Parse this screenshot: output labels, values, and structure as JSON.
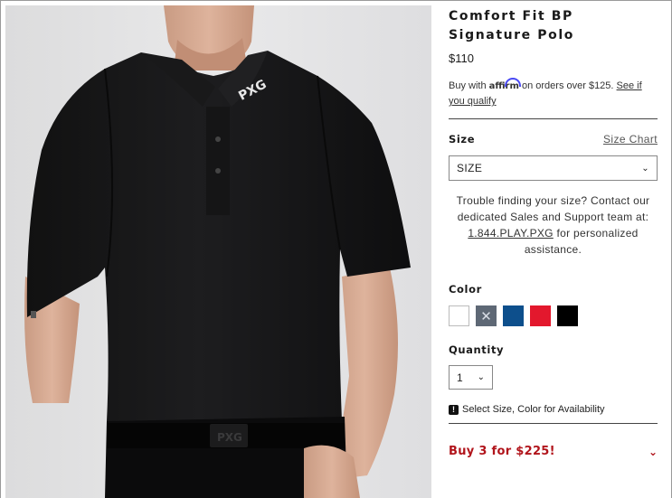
{
  "product": {
    "title_line1": "Comfort Fit BP",
    "title_line2": "Signature Polo",
    "price": "$110",
    "image_alt": "Man wearing black polo shirt with black belt"
  },
  "affirm": {
    "prefix": "Buy with",
    "brand": "affirm",
    "suffix": "on orders over $125.",
    "link": "See if you qualify"
  },
  "size": {
    "label": "Size",
    "chart_link": "Size Chart",
    "selected": "SIZE"
  },
  "help": {
    "text_before": "Trouble finding your size? Contact our dedicated Sales and Support team at:",
    "phone": "1.844.PLAY.PXG",
    "text_after": "for personalized assistance."
  },
  "color": {
    "label": "Color",
    "swatches": [
      {
        "name": "white",
        "hex": "#ffffff"
      },
      {
        "name": "charcoal",
        "hex": "#5e6875",
        "unavailable": true
      },
      {
        "name": "navy",
        "hex": "#0d4f8c"
      },
      {
        "name": "red",
        "hex": "#e3182d"
      },
      {
        "name": "black",
        "hex": "#000000"
      }
    ]
  },
  "quantity": {
    "label": "Quantity",
    "value": "1"
  },
  "availability": {
    "message": "Select Size, Color for Availability"
  },
  "promo": {
    "text": "Buy 3 for $225!"
  },
  "theme": {
    "accent": "#b1141b",
    "text": "#1a1a1a"
  }
}
